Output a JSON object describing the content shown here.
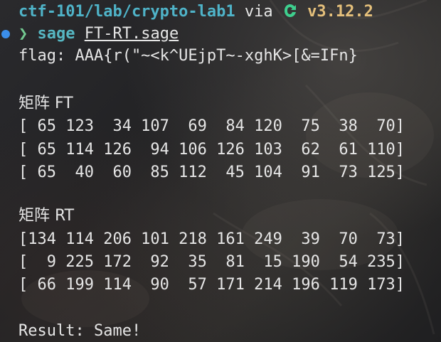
{
  "prompt": {
    "path": "ctf-101/lab/crypto-lab1",
    "via": "via",
    "version": "v3.12.2"
  },
  "command": {
    "chevron": "❯",
    "program": "sage",
    "file": "FT-RT.sage"
  },
  "output": {
    "flag_line": "flag: AAA{r(\"~<k^UEjpT~-xghK>[&=IFn}",
    "ft_title": "矩阵 FT",
    "ft_rows": [
      "[ 65 123  34 107  69  84 120  75  38  70]",
      "[ 65 114 126  94 106 126 103  62  61 110]",
      "[ 65  40  60  85 112  45 104  91  73 125]"
    ],
    "rt_title": "矩阵 RT",
    "rt_rows": [
      "[134 114 206 101 218 161 249  39  70  73]",
      "[  9 225 172  92  35  81  15 190  54 235]",
      "[ 66 199 114  90  57 171 214 196 119 173]"
    ],
    "result": "Result: Same!"
  },
  "colors": {
    "path": "#4fb3c8",
    "version": "#e5c07b",
    "command": "#56b6c2",
    "text": "#e6e6e6",
    "status_dot": "#3b8eea"
  }
}
